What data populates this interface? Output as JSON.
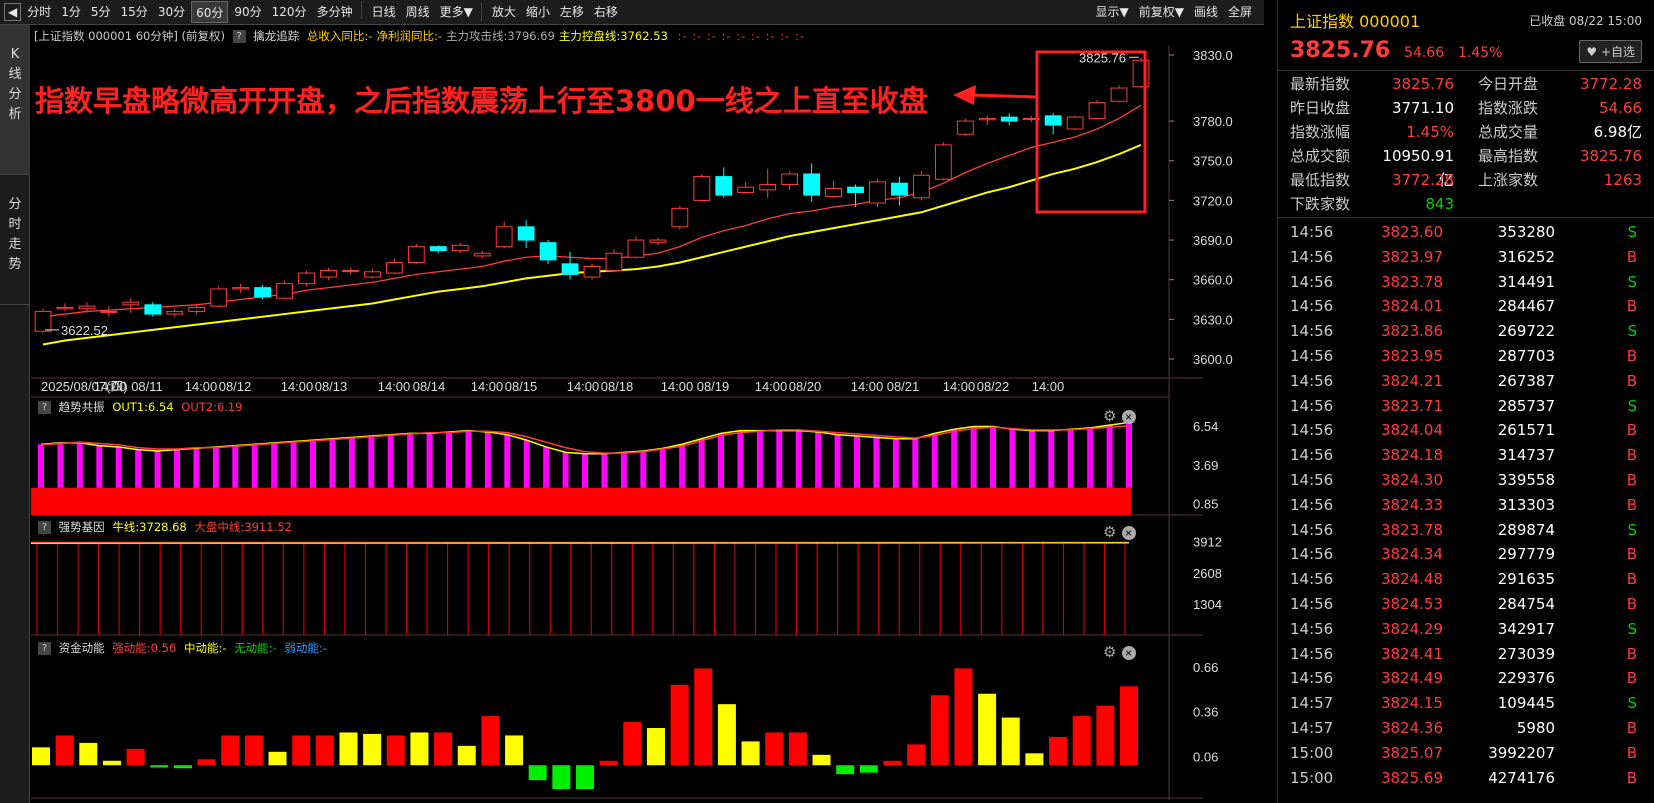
{
  "toolbar": {
    "periods": [
      "分时",
      "1分",
      "5分",
      "15分",
      "30分",
      "60分",
      "90分",
      "120分",
      "多分钟",
      "日线",
      "周线",
      "更多▼"
    ],
    "actions": [
      "放大",
      "缩小",
      "左移",
      "右移"
    ],
    "right": [
      "显示▼",
      "前复权▼",
      "画线",
      "全屏"
    ],
    "active": "60分"
  },
  "sidebar": {
    "tabs": [
      "K线分析",
      "分时走势"
    ]
  },
  "info_line": {
    "title": "[上证指数 000001 60分钟]  (前复权)",
    "tool": "擒龙追踪",
    "items": [
      {
        "text": "总收入同比:-",
        "color": "#ffcc00"
      },
      {
        "text": "净利润同比:-",
        "color": "#ffcc00"
      },
      {
        "text": "主力攻击线:3796.69",
        "color": "#aaaaaa"
      },
      {
        "text": "主力控盘线:3762.53",
        "color": "#ffff00"
      }
    ],
    "dashes": ":-  :-  :-  :-  :-  :-  :-  :-  :-"
  },
  "annotation": "指数早盘略微高开开盘，之后指数震荡上行至3800一线之上直至收盘",
  "panels": {
    "p2": {
      "name": "趋势共振",
      "l1": "OUT1:6.54",
      "l2": "OUT2:6.19"
    },
    "p3": {
      "name": "强势基因",
      "l1": "牛线:3728.68",
      "l2": "大盘中线:3911.52"
    },
    "p4": {
      "name": "资金动能",
      "l1": "强动能:0.56",
      "l2": "中动能:-",
      "l3": "无动能:-",
      "l4": "弱动能:-"
    }
  },
  "chart_data": [
    {
      "type": "candlestick",
      "title": "上证指数 000001 60分钟",
      "y_ticks": [
        "3830.0",
        "3780.0",
        "3750.0",
        "3720.0",
        "3690.0",
        "3660.0",
        "3630.0",
        "3600.0"
      ],
      "ylim": [
        3600,
        3830
      ],
      "x_labels": [
        "2025/08/07(四)",
        "14:00",
        "08/11",
        "14:00",
        "08/12",
        "14:00",
        "08/13",
        "14:00",
        "08/14",
        "14:00",
        "08/15",
        "14:00",
        "08/18",
        "14:00",
        "08/19",
        "14:00",
        "08/20",
        "14:00",
        "08/21",
        "14:00",
        "08/22",
        "14:00"
      ],
      "high_label": "3825.76",
      "low_label": "3622.52",
      "candles": [
        [
          3621,
          3636,
          3620,
          3638
        ],
        [
          3638,
          3639,
          3636,
          3642
        ],
        [
          3638,
          3640,
          3635,
          3643
        ],
        [
          3636,
          3636,
          3632,
          3640
        ],
        [
          3641,
          3643,
          3635,
          3646
        ],
        [
          3641,
          3634,
          3632,
          3643
        ],
        [
          3634,
          3636,
          3632,
          3638
        ],
        [
          3636,
          3639,
          3634,
          3642
        ],
        [
          3640,
          3653,
          3639,
          3655
        ],
        [
          3653,
          3654,
          3650,
          3657
        ],
        [
          3654,
          3647,
          3645,
          3656
        ],
        [
          3646,
          3657,
          3645,
          3659
        ],
        [
          3657,
          3665,
          3655,
          3667
        ],
        [
          3662,
          3667,
          3660,
          3669
        ],
        [
          3667,
          3667,
          3664,
          3669
        ],
        [
          3662,
          3666,
          3661,
          3668
        ],
        [
          3665,
          3673,
          3664,
          3676
        ],
        [
          3673,
          3685,
          3672,
          3687
        ],
        [
          3685,
          3682,
          3680,
          3686
        ],
        [
          3682,
          3686,
          3680,
          3688
        ],
        [
          3678,
          3680,
          3676,
          3682
        ],
        [
          3685,
          3700,
          3684,
          3704
        ],
        [
          3700,
          3690,
          3684,
          3705
        ],
        [
          3688,
          3675,
          3672,
          3690
        ],
        [
          3672,
          3664,
          3660,
          3681
        ],
        [
          3662,
          3670,
          3660,
          3672
        ],
        [
          3667,
          3680,
          3666,
          3683
        ],
        [
          3677,
          3690,
          3676,
          3693
        ],
        [
          3688,
          3690,
          3686,
          3692
        ],
        [
          3700,
          3714,
          3698,
          3716
        ],
        [
          3720,
          3738,
          3719,
          3740
        ],
        [
          3738,
          3724,
          3722,
          3745
        ],
        [
          3726,
          3730,
          3725,
          3734
        ],
        [
          3728,
          3732,
          3722,
          3744
        ],
        [
          3732,
          3740,
          3728,
          3742
        ],
        [
          3740,
          3724,
          3719,
          3748
        ],
        [
          3723,
          3729,
          3722,
          3735
        ],
        [
          3730,
          3726,
          3715,
          3732
        ],
        [
          3718,
          3734,
          3715,
          3736
        ],
        [
          3733,
          3724,
          3716,
          3738
        ],
        [
          3722,
          3739,
          3720,
          3742
        ],
        [
          3736,
          3762,
          3735,
          3764
        ],
        [
          3770,
          3780,
          3769,
          3782
        ],
        [
          3781,
          3782,
          3777,
          3784
        ],
        [
          3783,
          3780,
          3777,
          3786
        ],
        [
          3782,
          3782,
          3779,
          3784
        ],
        [
          3784,
          3777,
          3770,
          3786
        ],
        [
          3774,
          3783,
          3773,
          3784
        ],
        [
          3782,
          3794,
          3781,
          3796
        ],
        [
          3795,
          3805,
          3794,
          3807
        ],
        [
          3806,
          3826,
          3805,
          3828
        ]
      ],
      "ma_red": [
        3632,
        3634,
        3636,
        3637,
        3638,
        3639,
        3640,
        3641,
        3643,
        3645,
        3647,
        3649,
        3652,
        3654,
        3656,
        3658,
        3661,
        3664,
        3666,
        3668,
        3670,
        3674,
        3677,
        3678,
        3677,
        3676,
        3676,
        3678,
        3680,
        3685,
        3692,
        3697,
        3701,
        3706,
        3710,
        3712,
        3715,
        3717,
        3720,
        3722,
        3726,
        3733,
        3741,
        3748,
        3754,
        3760,
        3764,
        3768,
        3774,
        3782,
        3792
      ],
      "ma_yellow": [
        3611,
        3614,
        3616,
        3618,
        3620,
        3622,
        3624,
        3626,
        3628,
        3630,
        3632,
        3634,
        3636,
        3638,
        3640,
        3642,
        3645,
        3648,
        3651,
        3653,
        3655,
        3658,
        3661,
        3663,
        3665,
        3666,
        3667,
        3668,
        3670,
        3673,
        3677,
        3681,
        3685,
        3689,
        3693,
        3696,
        3699,
        3702,
        3705,
        3708,
        3711,
        3716,
        3721,
        3726,
        3730,
        3735,
        3740,
        3744,
        3749,
        3755,
        3762
      ]
    },
    {
      "type": "bar",
      "title": "趋势共振",
      "y_ticks": [
        "6.54",
        "3.69",
        "0.85"
      ],
      "ylim": [
        0,
        7.2
      ],
      "values": [
        5.2,
        5.3,
        5.3,
        5.1,
        5.0,
        4.8,
        4.7,
        4.8,
        4.9,
        5.0,
        5.1,
        5.2,
        5.3,
        5.4,
        5.5,
        5.6,
        5.7,
        5.8,
        5.9,
        6.0,
        6.0,
        6.1,
        6.2,
        6.1,
        5.9,
        5.5,
        5.0,
        4.6,
        4.5,
        4.5,
        4.6,
        4.7,
        4.9,
        5.2,
        5.6,
        6.0,
        6.2,
        6.2,
        6.2,
        6.2,
        6.1,
        5.9,
        5.8,
        5.7,
        5.6,
        5.6,
        6.0,
        6.3,
        6.5,
        6.5,
        6.3,
        6.2,
        6.2,
        6.3,
        6.4,
        6.6,
        6.8
      ],
      "line1": [
        5.2,
        5.3,
        5.3,
        5.1,
        5.0,
        4.8,
        4.7,
        4.8,
        4.9,
        5.0,
        5.1,
        5.2,
        5.3,
        5.4,
        5.5,
        5.6,
        5.7,
        5.8,
        5.9,
        6.0,
        6.0,
        6.1,
        6.2,
        6.1,
        5.9,
        5.5,
        5.0,
        4.6,
        4.5,
        4.5,
        4.6,
        4.7,
        4.9,
        5.2,
        5.6,
        6.0,
        6.2,
        6.2,
        6.2,
        6.2,
        6.1,
        5.9,
        5.8,
        5.7,
        5.6,
        5.6,
        6.0,
        6.3,
        6.5,
        6.5,
        6.3,
        6.2,
        6.2,
        6.3,
        6.4,
        6.6,
        6.8
      ],
      "line2": [
        5.1,
        5.2,
        5.3,
        5.2,
        5.1,
        4.9,
        4.8,
        4.8,
        4.9,
        4.9,
        5.0,
        5.1,
        5.2,
        5.3,
        5.4,
        5.5,
        5.6,
        5.7,
        5.8,
        5.9,
        6.0,
        6.0,
        6.1,
        6.1,
        6.0,
        5.7,
        5.3,
        4.9,
        4.6,
        4.5,
        4.5,
        4.6,
        4.8,
        5.0,
        5.4,
        5.8,
        6.0,
        6.1,
        6.2,
        6.2,
        6.1,
        6.0,
        5.9,
        5.8,
        5.7,
        5.6,
        5.8,
        6.1,
        6.3,
        6.4,
        6.3,
        6.2,
        6.2,
        6.2,
        6.3,
        6.4,
        6.5
      ]
    },
    {
      "type": "bar",
      "title": "强势基因",
      "y_ticks": [
        "3912",
        "2608",
        "1304"
      ],
      "ylim": [
        0,
        4400
      ],
      "bars": 54
    },
    {
      "type": "bar",
      "title": "资金动能",
      "y_ticks": [
        "0.66",
        "0.36",
        "0.06"
      ],
      "ylim": [
        -0.22,
        0.72
      ],
      "values": [
        0.12,
        0.2,
        0.15,
        0.03,
        0.11,
        -0.01,
        -0.02,
        0.04,
        0.2,
        0.2,
        0.09,
        0.2,
        0.2,
        0.22,
        0.21,
        0.2,
        0.22,
        0.22,
        0.13,
        0.33,
        0.2,
        -0.1,
        -0.16,
        -0.16,
        0.03,
        0.29,
        0.25,
        0.54,
        0.65,
        0.41,
        0.16,
        0.22,
        0.22,
        0.07,
        -0.06,
        -0.05,
        0.03,
        0.14,
        0.47,
        0.65,
        0.48,
        0.32,
        0.08,
        0.19,
        0.33,
        0.4,
        0.53
      ],
      "colors": [
        "y",
        "r",
        "y",
        "y",
        "r",
        "g",
        "g",
        "r",
        "r",
        "r",
        "y",
        "r",
        "r",
        "y",
        "y",
        "r",
        "y",
        "r",
        "y",
        "r",
        "y",
        "g",
        "g",
        "g",
        "r",
        "r",
        "y",
        "r",
        "r",
        "y",
        "y",
        "r",
        "r",
        "y",
        "g",
        "g",
        "r",
        "r",
        "r",
        "r",
        "y",
        "y",
        "y",
        "r",
        "r",
        "r",
        "r"
      ]
    }
  ],
  "right": {
    "name": "上证指数  000001",
    "status": "已收盘 08/22 15:00",
    "price": "3825.76",
    "change": "54.66",
    "pct": "1.45%",
    "add": "+自选",
    "quote": [
      {
        "k": "最新指数",
        "v": "3825.76",
        "c": "red",
        "k2": "今日开盘",
        "v2": "3772.28",
        "c2": "red"
      },
      {
        "k": "昨日收盘",
        "v": "3771.10",
        "c": "white",
        "k2": "指数涨跌",
        "v2": "54.66",
        "c2": "red"
      },
      {
        "k": "指数涨幅",
        "v": "1.45%",
        "c": "red",
        "k2": "总成交量",
        "v2": "6.98亿",
        "c2": "white"
      },
      {
        "k": "总成交额",
        "v": "10950.91亿",
        "c": "white",
        "k2": "最高指数",
        "v2": "3825.76",
        "c2": "red"
      },
      {
        "k": "最低指数",
        "v": "3772.28",
        "c": "red",
        "k2": "上涨家数",
        "v2": "1263",
        "c2": "red"
      },
      {
        "k": "下跌家数",
        "v": "843",
        "c": "green",
        "k2": "",
        "v2": "",
        "c2": "white"
      }
    ],
    "ticks": [
      [
        "14:56",
        "3823.60",
        "353280",
        "S"
      ],
      [
        "14:56",
        "3823.97",
        "316252",
        "B"
      ],
      [
        "14:56",
        "3823.78",
        "314491",
        "S"
      ],
      [
        "14:56",
        "3824.01",
        "284467",
        "B"
      ],
      [
        "14:56",
        "3823.86",
        "269722",
        "S"
      ],
      [
        "14:56",
        "3823.95",
        "287703",
        "B"
      ],
      [
        "14:56",
        "3824.21",
        "267387",
        "B"
      ],
      [
        "14:56",
        "3823.71",
        "285737",
        "S"
      ],
      [
        "14:56",
        "3824.04",
        "261571",
        "B"
      ],
      [
        "14:56",
        "3824.18",
        "314737",
        "B"
      ],
      [
        "14:56",
        "3824.30",
        "339558",
        "B"
      ],
      [
        "14:56",
        "3824.33",
        "313303",
        "B"
      ],
      [
        "14:56",
        "3823.78",
        "289874",
        "S"
      ],
      [
        "14:56",
        "3824.34",
        "297779",
        "B"
      ],
      [
        "14:56",
        "3824.48",
        "291635",
        "B"
      ],
      [
        "14:56",
        "3824.53",
        "284754",
        "B"
      ],
      [
        "14:56",
        "3824.29",
        "342917",
        "S"
      ],
      [
        "14:56",
        "3824.41",
        "273039",
        "B"
      ],
      [
        "14:56",
        "3824.49",
        "229376",
        "B"
      ],
      [
        "14:57",
        "3824.15",
        "109445",
        "S"
      ],
      [
        "14:57",
        "3824.36",
        "5980",
        "B"
      ],
      [
        "15:00",
        "3825.07",
        "3992207",
        "B"
      ],
      [
        "15:00",
        "3825.69",
        "4274176",
        "B"
      ]
    ]
  }
}
